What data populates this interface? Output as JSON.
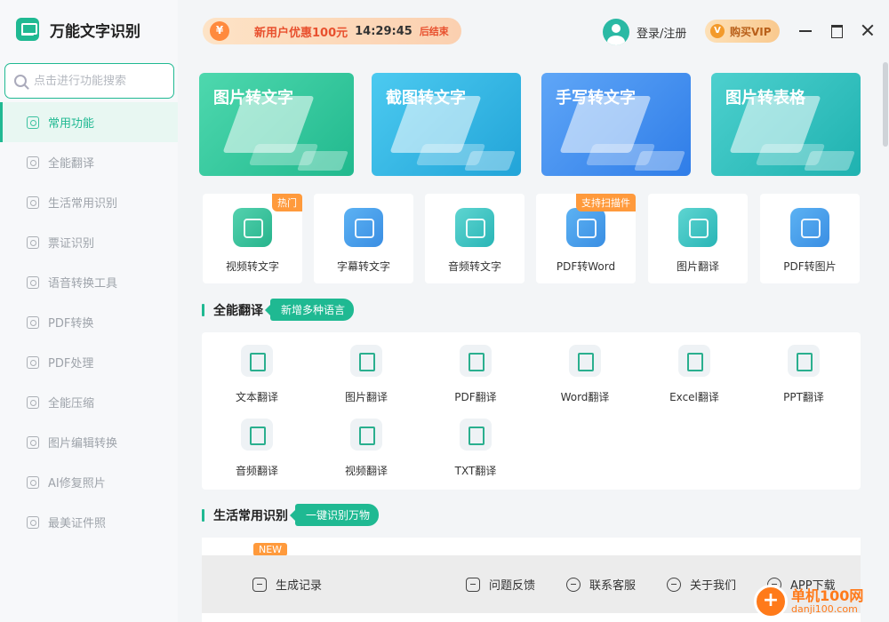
{
  "app": {
    "title": "万能文字识别"
  },
  "sidebar": {
    "search_placeholder": "点击进行功能搜索",
    "items": [
      {
        "label": "常用功能",
        "active": true
      },
      {
        "label": "全能翻译"
      },
      {
        "label": "生活常用识别"
      },
      {
        "label": "票证识别"
      },
      {
        "label": "语音转换工具"
      },
      {
        "label": "PDF转换"
      },
      {
        "label": "PDF处理"
      },
      {
        "label": "全能压缩"
      },
      {
        "label": "图片编辑转换"
      },
      {
        "label": "AI修复照片"
      },
      {
        "label": "最美证件照"
      }
    ]
  },
  "header": {
    "promo_text": "新用户优惠100元",
    "promo_time": "14:29:45",
    "promo_end": "后结束",
    "login_label": "登录/注册",
    "vip_badge": "V",
    "vip_label": "购买VIP"
  },
  "feature_cards": [
    {
      "title": "图片转文字"
    },
    {
      "title": "截图转文字"
    },
    {
      "title": "手写转文字"
    },
    {
      "title": "图片转表格"
    }
  ],
  "tools": [
    {
      "label": "视频转文字",
      "badge": "热门"
    },
    {
      "label": "字幕转文字"
    },
    {
      "label": "音频转文字"
    },
    {
      "label": "PDF转Word",
      "badge": "支持扫描件"
    },
    {
      "label": "图片翻译"
    },
    {
      "label": "PDF转图片"
    }
  ],
  "translate_section": {
    "title": "全能翻译",
    "tag": "新增多种语言",
    "items": [
      {
        "label": "文本翻译"
      },
      {
        "label": "图片翻译"
      },
      {
        "label": "PDF翻译"
      },
      {
        "label": "Word翻译"
      },
      {
        "label": "Excel翻译"
      },
      {
        "label": "PPT翻译"
      },
      {
        "label": "音频翻译"
      },
      {
        "label": "视频翻译"
      },
      {
        "label": "TXT翻译"
      }
    ]
  },
  "life_section": {
    "title": "生活常用识别",
    "tag": "一键识别万物",
    "new_badge": "NEW"
  },
  "footer": {
    "items": [
      {
        "label": "生成记录"
      },
      {
        "label": "问题反馈"
      },
      {
        "label": "联系客服"
      },
      {
        "label": "关于我们"
      },
      {
        "label": "APP下载"
      }
    ]
  },
  "watermark": {
    "name": "单机100网",
    "url": "danji100.com"
  },
  "colors": {
    "accent": "#1fb992",
    "promo": "#e8502e",
    "badge": "#ff9a3c"
  }
}
